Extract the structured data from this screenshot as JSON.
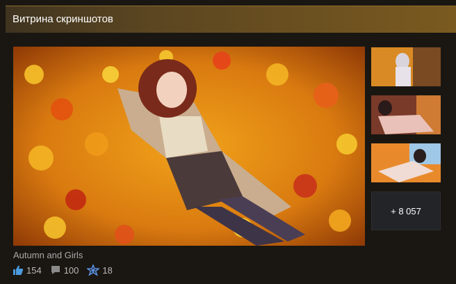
{
  "header": {
    "title": "Витрина скриншотов"
  },
  "showcase": {
    "main_title": "Autumn and Girls",
    "more_label": "+ 8 057",
    "stats": {
      "likes": "154",
      "comments": "100",
      "awards": "18"
    }
  },
  "colors": {
    "header_gradient_start": "#3f3420",
    "header_gradient_end": "#7a5a1f",
    "like_icon": "#4b9be0",
    "award_icon": "#5a8fe0",
    "comment_icon": "#8a8a8a"
  },
  "icons": {
    "like": "thumbs-up-icon",
    "comment": "speech-bubble-icon",
    "award": "award-star-icon"
  }
}
